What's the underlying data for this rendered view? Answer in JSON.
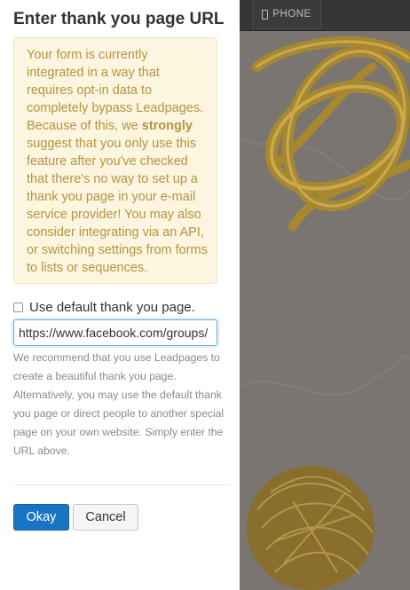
{
  "dialog": {
    "title": "Enter thank you page URL",
    "warning": {
      "before": "Your form is currently integrated in a way that requires opt-in data to completely bypass Leadpages. Because of this, we ",
      "strong": "strongly",
      "after": " suggest that you only use this feature after you've checked that there's no way to set up a thank you page in your e-mail service provider! You may also consider integrating via an API, or switching settings from forms to lists or sequences."
    },
    "checkbox_label": "Use default thank you page.",
    "checkbox_checked": false,
    "url_value": "https://www.facebook.com/groups/",
    "help_text": "We recommend that you use Leadpages to create a beautiful thank you page. Alternatively, you may use the default thank you page or direct people to another special page on your own website. Simply enter the URL above.",
    "ok_label": "Okay",
    "cancel_label": "Cancel"
  },
  "preview": {
    "phone_tab_label": "PHONE",
    "phone_icon": "phone-icon"
  },
  "colors": {
    "primary_button": "#1a74c4",
    "warning_bg": "#fcf5df",
    "warning_text": "#b5953f"
  }
}
